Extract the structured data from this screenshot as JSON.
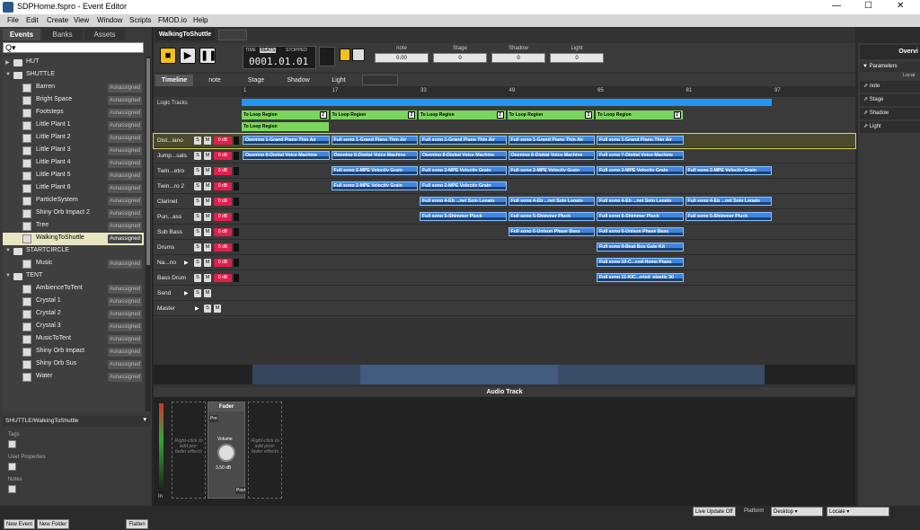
{
  "window": {
    "title": "SDPHome.fspro - Event Editor",
    "minimize": "—",
    "maximize": "☐",
    "close": "✕"
  },
  "menu": [
    "File",
    "Edit",
    "Create",
    "View",
    "Window",
    "Scripts",
    "FMOD.io",
    "Help"
  ],
  "browser": {
    "tabs": [
      "Events",
      "Banks",
      "Assets"
    ],
    "search_icon": "Q▾",
    "items": [
      {
        "type": "folder",
        "label": "HUT",
        "open": false,
        "level": 0
      },
      {
        "type": "folder",
        "label": "SHUTTLE",
        "open": true,
        "level": 0
      },
      {
        "type": "event",
        "label": "Barren",
        "level": 1,
        "tag": "#unassigned"
      },
      {
        "type": "event",
        "label": "Bright Space",
        "level": 1,
        "tag": "#unassigned"
      },
      {
        "type": "event",
        "label": "Footsteps",
        "level": 1,
        "tag": "#unassigned"
      },
      {
        "type": "event",
        "label": "Little Plant 1",
        "level": 1,
        "tag": "#unassigned"
      },
      {
        "type": "event",
        "label": "Little Plant 2",
        "level": 1,
        "tag": "#unassigned"
      },
      {
        "type": "event",
        "label": "Little Plant 3",
        "level": 1,
        "tag": "#unassigned"
      },
      {
        "type": "event",
        "label": "Little Plant 4",
        "level": 1,
        "tag": "#unassigned"
      },
      {
        "type": "event",
        "label": "Little Plant 5",
        "level": 1,
        "tag": "#unassigned"
      },
      {
        "type": "event",
        "label": "Little Plant 6",
        "level": 1,
        "tag": "#unassigned"
      },
      {
        "type": "event",
        "label": "ParticleSystem",
        "level": 1,
        "tag": "#unassigned"
      },
      {
        "type": "event",
        "label": "Shiny Orb Impact 2",
        "level": 1,
        "tag": "#unassigned"
      },
      {
        "type": "event",
        "label": "Tree",
        "level": 1,
        "tag": "#unassigned"
      },
      {
        "type": "event",
        "label": "WalkingToShuttle",
        "level": 1,
        "tag": "#unassigned",
        "selected": true
      },
      {
        "type": "folder",
        "label": "STARTCIRCLE",
        "open": true,
        "level": 0
      },
      {
        "type": "event",
        "label": "Music",
        "level": 1,
        "tag": "#unassigned"
      },
      {
        "type": "folder",
        "label": "TENT",
        "open": true,
        "level": 0
      },
      {
        "type": "event",
        "label": "AmbienceToTent",
        "level": 1,
        "tag": "#unassigned"
      },
      {
        "type": "event",
        "label": "Crystal 1",
        "level": 1,
        "tag": "#unassigned"
      },
      {
        "type": "event",
        "label": "Crystal 2",
        "level": 1,
        "tag": "#unassigned"
      },
      {
        "type": "event",
        "label": "Crystal 3",
        "level": 1,
        "tag": "#unassigned"
      },
      {
        "type": "event",
        "label": "MusicToTent",
        "level": 1,
        "tag": "#unassigned"
      },
      {
        "type": "event",
        "label": "Shiny Orb Impact",
        "level": 1,
        "tag": "#unassigned"
      },
      {
        "type": "event",
        "label": "Shiny Orb Sus",
        "level": 1,
        "tag": "#unassigned"
      },
      {
        "type": "event",
        "label": "Water",
        "level": 1,
        "tag": "#unassigned"
      }
    ],
    "path": "SHUTTLE/WalkingToShuttle",
    "path_arrow": "▼",
    "props": [
      "Tags",
      "User Properties",
      "Notes"
    ],
    "buttons": [
      "New Event",
      "New Folder",
      "Flatten"
    ]
  },
  "editor": {
    "tab": "WalkingToShuttle",
    "time_labels": [
      "TIME",
      "BEATS",
      "STOPPED"
    ],
    "time_value": "0001.01.01",
    "params": [
      {
        "name": "note",
        "value": "0.00"
      },
      {
        "name": "Stage",
        "value": "0"
      },
      {
        "name": "Shadow",
        "value": "0"
      },
      {
        "name": "Light",
        "value": "0"
      }
    ],
    "subtabs": [
      "Timeline",
      "note",
      "Stage",
      "Shadow",
      "Light"
    ],
    "ruler": [
      "1",
      "17",
      "33",
      "49",
      "65",
      "81",
      "97"
    ],
    "logic_label": "Logic Tracks",
    "loop_label": "To Loop Region",
    "tracks": [
      "Dist...iano",
      "Jump...sals",
      "Twin...etro",
      "Twin...ro 2",
      "Clarinet",
      "Pun...ass",
      "Sub Bass",
      "Drums",
      "Na...no",
      "Bass Drum",
      "Send",
      "Master"
    ],
    "fader_label": "0 dB",
    "clips": {
      "r0": "Opening 1-Grand Piano Thin Air",
      "r0b": "Full song 1-Grand Piano Thin Air",
      "r1": "Opening 8-Digital Voice Machine",
      "r1b": "Full song 7-Digital Voice Machine",
      "r2": "Full song 2-MPE Velocity Grain",
      "r4": "Full song 4-Eb ...net Solo Legato",
      "r5": "Full song 5-Shimmer Pluck",
      "r6": "Full song 6-Unison Phase Bass",
      "r7": "Full song 9-Beat Box Gate Kit",
      "r8": "Full song 10-C...ced Home Piano",
      "r9": "Full song 11-KIC...rried_plastic 30"
    },
    "deck_title": "Audio Track",
    "pre_effects": "Right-click to add pre-fader effects",
    "post_effects": "Right-click to add post-fader effects",
    "fader_title": "Fader",
    "pre": "Pre",
    "post": "Post",
    "volume": "Volume",
    "volume_value": "3.50 dB",
    "in_label": "In"
  },
  "overview": {
    "title": "Overvi",
    "params_title": "Parameters",
    "local": "Local",
    "params": [
      "note",
      "Stage",
      "Shadow",
      "Light"
    ]
  },
  "status": {
    "live_update": "Live Update Off",
    "platform_label": "Platform",
    "platform": "Desktop",
    "locale": "Locale"
  }
}
